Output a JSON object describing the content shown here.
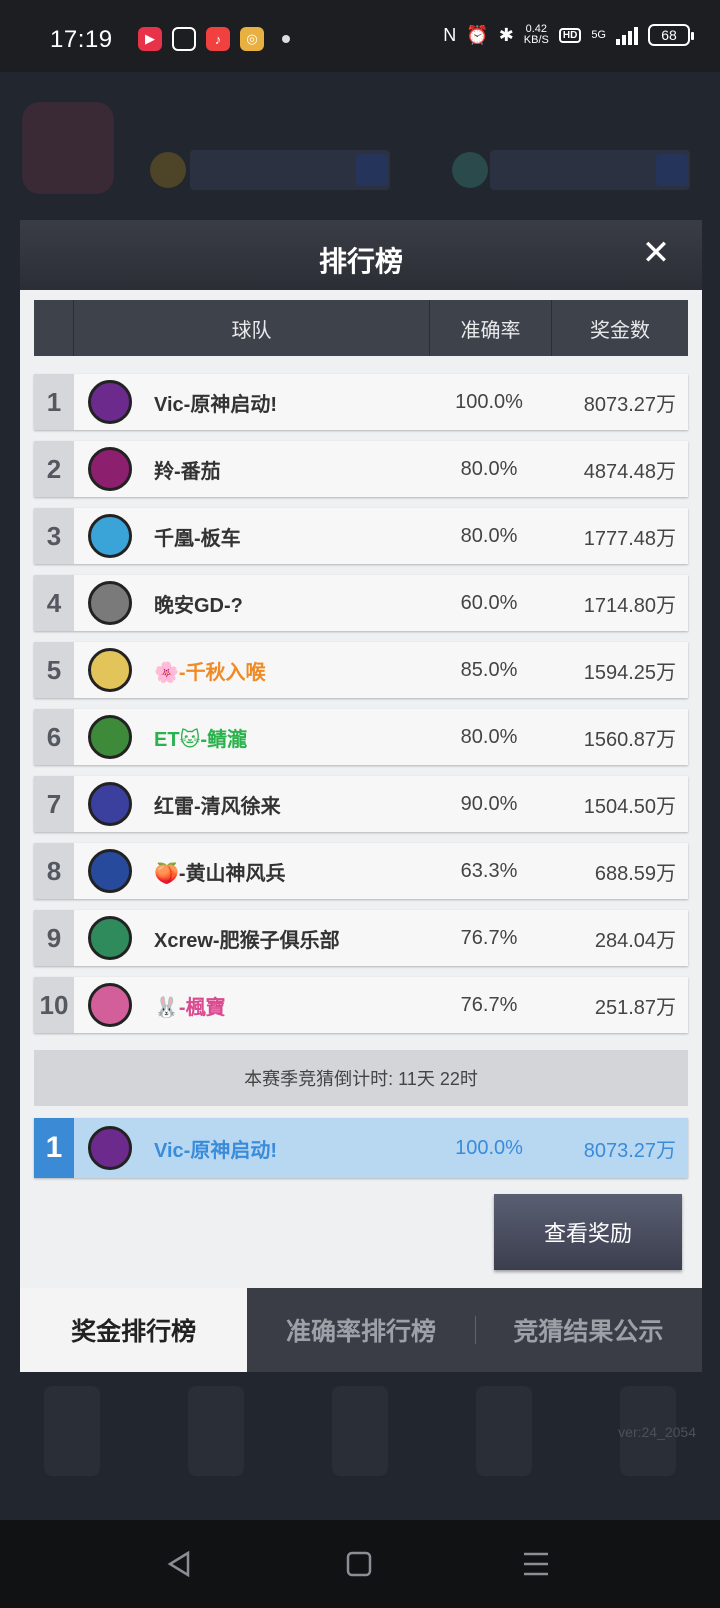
{
  "status_bar": {
    "time": "17:19",
    "net_speed": "0.42",
    "net_unit": "KB/S",
    "hd": "HD",
    "signal": "5G",
    "battery": "68"
  },
  "background": {
    "version": "ver:24_2054"
  },
  "modal": {
    "title": "排行榜",
    "close_icon": "close-icon",
    "columns": [
      "球队",
      "准确率",
      "奖金数"
    ],
    "rows": [
      {
        "rank": "1",
        "team": "Vic-原神启动!",
        "accuracy": "100.0%",
        "prize": "8073.27万",
        "logo_color": "#6b2a8c"
      },
      {
        "rank": "2",
        "team": "羚-番茄",
        "accuracy": "80.0%",
        "prize": "4874.48万",
        "logo_color": "#8c1f6e"
      },
      {
        "rank": "3",
        "team": "千凰-板车",
        "accuracy": "80.0%",
        "prize": "1777.48万",
        "logo_color": "#3aa4d8"
      },
      {
        "rank": "4",
        "team": "晚安GD-?",
        "accuracy": "60.0%",
        "prize": "1714.80万",
        "logo_color": "#7a7a7a"
      },
      {
        "rank": "5",
        "team": "🌸-千秋入喉",
        "accuracy": "85.0%",
        "prize": "1594.25万",
        "logo_color": "#e3c45a",
        "name_color": "#f08a24"
      },
      {
        "rank": "6",
        "team": "ET🐱-鲭瀧",
        "accuracy": "80.0%",
        "prize": "1560.87万",
        "logo_color": "#3d8a3a",
        "name_color": "#2bb24c"
      },
      {
        "rank": "7",
        "team": "红雷-清风徐来",
        "accuracy": "90.0%",
        "prize": "1504.50万",
        "logo_color": "#3b3f9e"
      },
      {
        "rank": "8",
        "team": "🍑-黄山神风兵",
        "accuracy": "63.3%",
        "prize": "688.59万",
        "logo_color": "#274a9c"
      },
      {
        "rank": "9",
        "team": "Xcrew-肥猴子俱乐部",
        "accuracy": "76.7%",
        "prize": "284.04万",
        "logo_color": "#2f8a5c"
      },
      {
        "rank": "10",
        "team": "🐰-楓寶",
        "accuracy": "76.7%",
        "prize": "251.87万",
        "logo_color": "#d35f9a",
        "name_color": "#d94a8f"
      }
    ],
    "countdown": "本赛季竞猜倒计时: 11天 22时",
    "my_row": {
      "rank": "1",
      "team": "Vic-原神启动!",
      "accuracy": "100.0%",
      "prize": "8073.27万"
    },
    "reward_button": "查看奖励",
    "tabs": [
      "奖金排行榜",
      "准确率排行榜",
      "竞猜结果公示"
    ]
  }
}
